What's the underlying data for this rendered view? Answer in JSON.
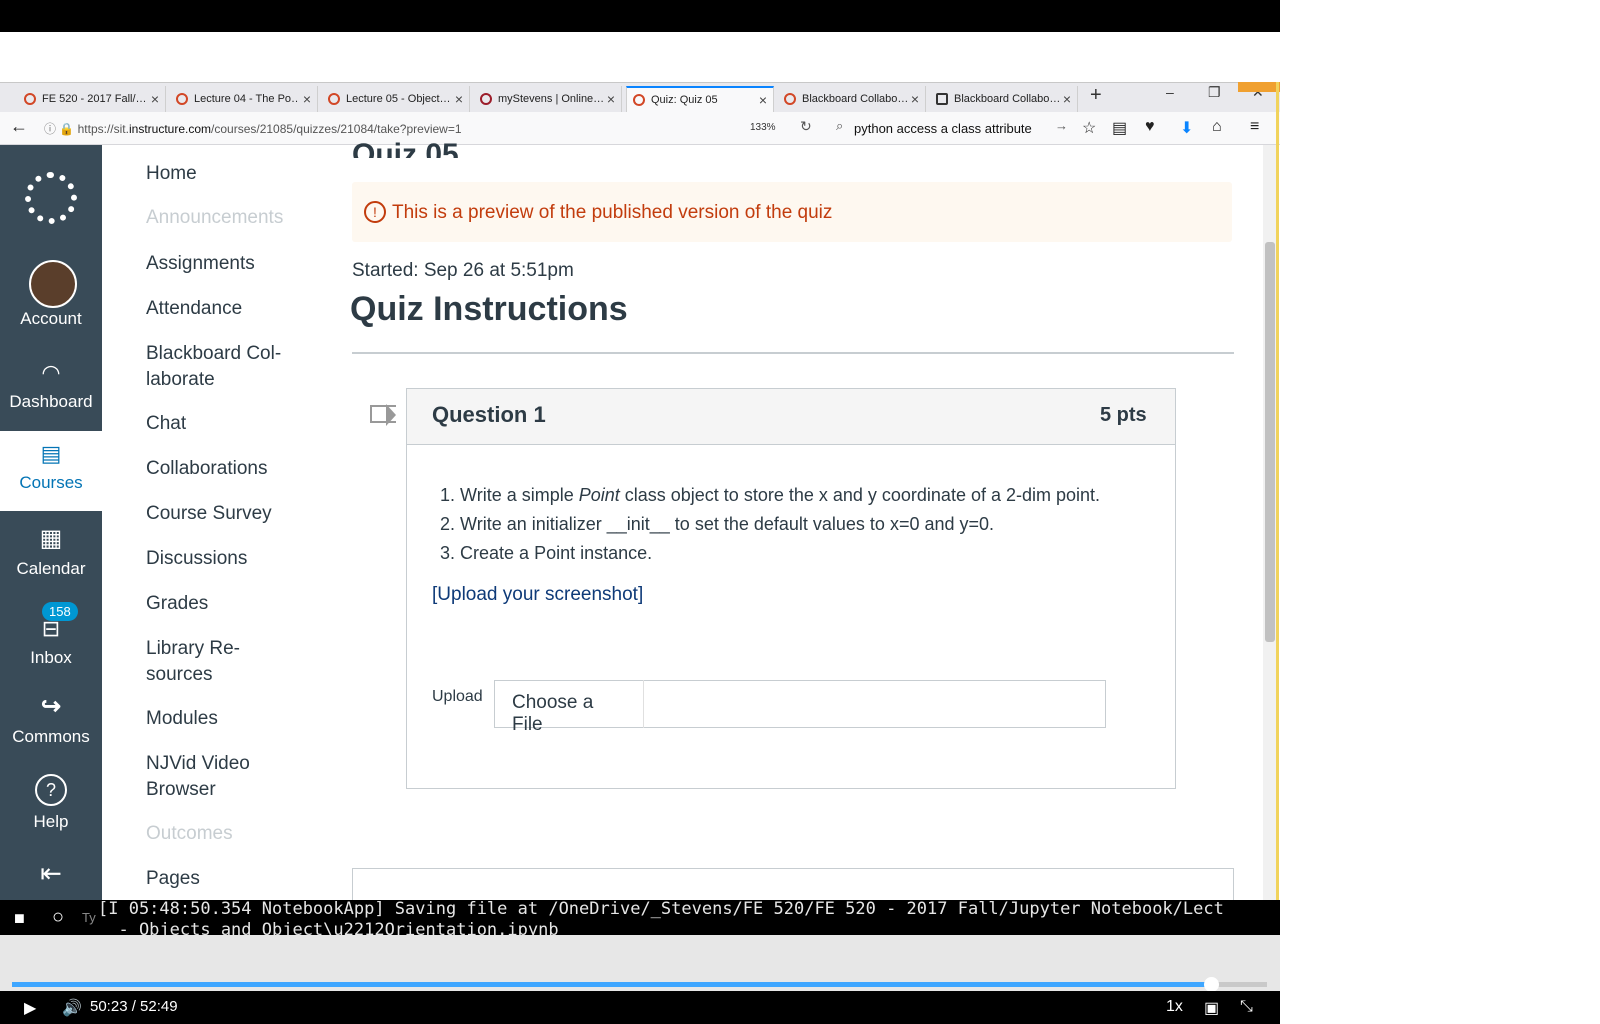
{
  "browser": {
    "tabs": [
      {
        "title": "FE 520 - 2017 Fall/…"
      },
      {
        "title": "Lecture 04 - The Po…"
      },
      {
        "title": "Lecture 05 - Object…"
      },
      {
        "title": "myStevens | Online…"
      },
      {
        "title": "Quiz: Quiz 05"
      },
      {
        "title": "Blackboard Collabo…"
      },
      {
        "title": "Blackboard Collabo…"
      }
    ],
    "url_prefix": "https://sit.",
    "url_domain": "instructure.com",
    "url_path": "/courses/21085/quizzes/21084/take?preview=1",
    "zoom": "133%",
    "search_text": "python access a class attribute"
  },
  "global_nav": {
    "account": "Account",
    "dashboard": "Dashboard",
    "courses": "Courses",
    "calendar": "Calendar",
    "inbox": "Inbox",
    "inbox_count": "158",
    "commons": "Commons",
    "help": "Help"
  },
  "course_nav": {
    "items": [
      {
        "label": "Home"
      },
      {
        "label": "Announcements"
      },
      {
        "label": "Assignments"
      },
      {
        "label": "Attendance"
      },
      {
        "label": "Blackboard Col-"
      },
      {
        "label": "laborate"
      },
      {
        "label": "Chat"
      },
      {
        "label": "Collaborations"
      },
      {
        "label": "Course Survey"
      },
      {
        "label": "Discussions"
      },
      {
        "label": "Grades"
      },
      {
        "label": "Library Re-"
      },
      {
        "label": "sources"
      },
      {
        "label": "Modules"
      },
      {
        "label": "NJVid Video"
      },
      {
        "label": "Browser"
      },
      {
        "label": "Outcomes"
      },
      {
        "label": "Pages"
      }
    ]
  },
  "main": {
    "title_partial": "Quiz 05",
    "preview_notice": "This is a preview of the published version of the quiz",
    "started": "Started: Sep 26 at 5:51pm",
    "instructions_heading": "Quiz Instructions",
    "question": {
      "title": "Question 1",
      "points": "5 pts",
      "lines": [
        {
          "num": "1.",
          "before": "Write a simple ",
          "em": "Point",
          "after": " class object to store the x and y coordinate of a 2-dim point."
        },
        {
          "num": "2.",
          "text": "Write an initializer __init__ to set the default values to x=0 and y=0."
        },
        {
          "num": "3.",
          "text": "Create a Point instance."
        }
      ],
      "upload_link": "[Upload your screenshot]",
      "upload_label": "Upload",
      "choose_file": "Choose a File"
    }
  },
  "console": {
    "line1": "[I 05:48:50.354 NotebookApp] Saving file at /OneDrive/_Stevens/FE 520/FE 520 - 2017 Fall/Jupyter Notebook/Lect",
    "line2": "  - Objects and Object\\u2212Orientation.ipynb",
    "taskbar_hint": "Ty"
  },
  "player": {
    "time": "50:23 / 52:49",
    "speed": "1x",
    "progress": 0.955
  },
  "colors": {
    "nav_bg": "#394b58",
    "link": "#0374b5",
    "warning": "#c23c0d",
    "progress": "#3ea6ff"
  }
}
